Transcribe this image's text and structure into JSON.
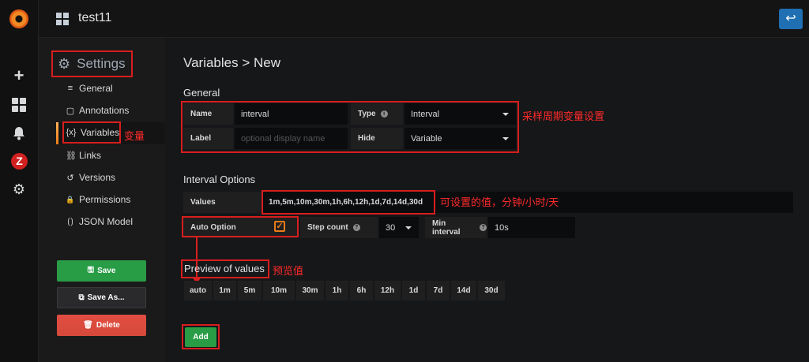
{
  "app": {
    "rail_icons": [
      "grafana-logo-icon",
      "plus-icon",
      "dashboards-grid-icon",
      "bell-icon",
      "zabbix-icon",
      "gear-icon"
    ],
    "zabbix_letter": "Z"
  },
  "topbar": {
    "dashboard_title": "test11",
    "back_icon": "↩"
  },
  "sidebar": {
    "heading": "Settings",
    "items": [
      {
        "label": "General",
        "icon": "≡"
      },
      {
        "label": "Annotations",
        "icon": "▢"
      },
      {
        "label": "Variables",
        "icon": "{x}"
      },
      {
        "label": "Links",
        "icon": "⛓"
      },
      {
        "label": "Versions",
        "icon": "↺"
      },
      {
        "label": "Permissions",
        "icon": "🔒"
      },
      {
        "label": "JSON Model",
        "icon": "⟮⟯"
      }
    ],
    "active": "Variables",
    "save_label": "Save",
    "save_as_label": "Save As...",
    "delete_label": "Delete"
  },
  "main": {
    "page_title": "Variables > New",
    "general": {
      "title": "General",
      "name_label": "Name",
      "name_value": "interval",
      "type_label": "Type",
      "type_value": "Interval",
      "label_label": "Label",
      "label_placeholder": "optional display name",
      "hide_label": "Hide",
      "hide_value": "Variable"
    },
    "interval_options": {
      "title": "Interval Options",
      "values_label": "Values",
      "values_value": "1m,5m,10m,30m,1h,6h,12h,1d,7d,14d,30d",
      "auto_option_label": "Auto Option",
      "auto_option_checked": true,
      "step_count_label": "Step count",
      "step_count_value": "30",
      "min_interval_label": "Min interval",
      "min_interval_value": "10s"
    },
    "preview": {
      "title": "Preview of values",
      "values": [
        "auto",
        "1m",
        "5m",
        "10m",
        "30m",
        "1h",
        "6h",
        "12h",
        "1d",
        "7d",
        "14d",
        "30d"
      ]
    },
    "add_label": "Add"
  },
  "annotations": {
    "variables_note": "变量",
    "general_note": "采样周期变量设置",
    "values_note": "可设置的值，分钟/小时/天",
    "preview_note": "预览值"
  },
  "colors": {
    "annotation_red": "#d81e1e",
    "save_green": "#299c46",
    "delete_red": "#e24d42",
    "accent_orange": "#eb7b18",
    "back_blue": "#1f6fb2"
  }
}
